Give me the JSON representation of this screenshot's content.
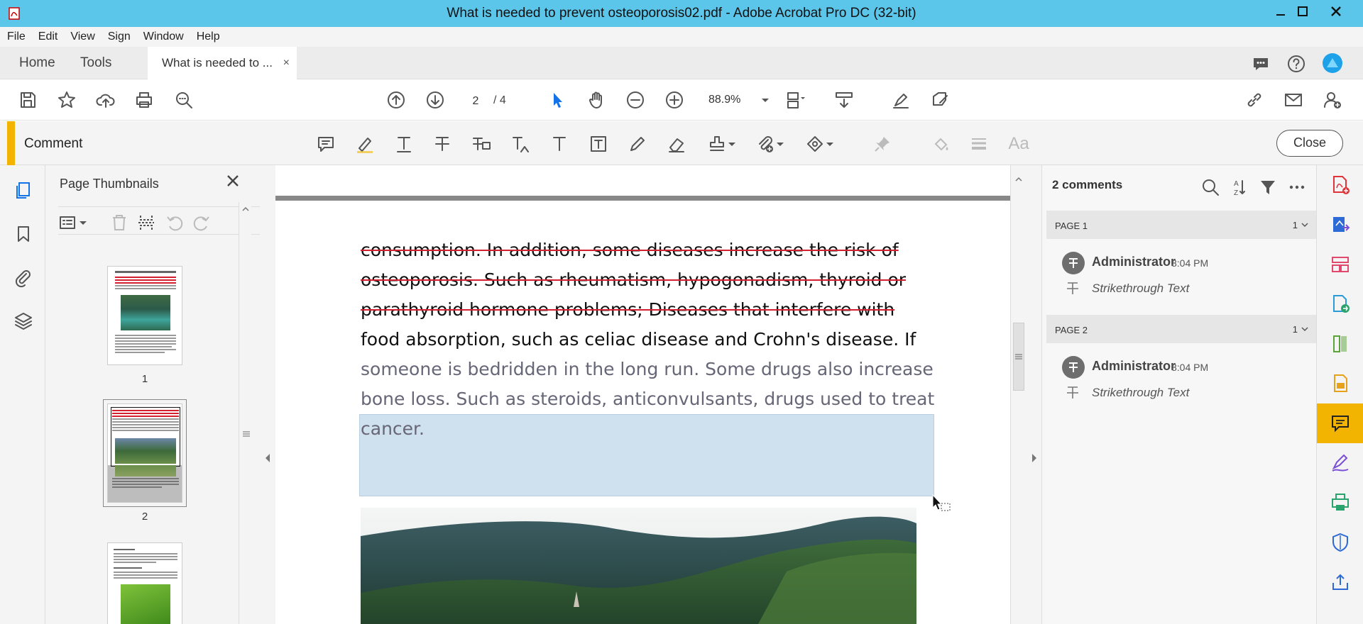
{
  "window": {
    "title": "What is needed to prevent osteoporosis02.pdf - Adobe Acrobat Pro DC (32-bit)"
  },
  "menu": [
    "File",
    "Edit",
    "View",
    "Sign",
    "Window",
    "Help"
  ],
  "tabs": {
    "home": "Home",
    "tools": "Tools",
    "document": "What is needed to ...",
    "document_close": "×"
  },
  "toolbar": {
    "current_page": "2",
    "page_total": "/ 4",
    "zoom": "88.9%"
  },
  "comment_toolbar": {
    "label": "Comment",
    "close_label": "Close"
  },
  "thumbnails": {
    "title": "Page Thumbnails",
    "pages": [
      "1",
      "2"
    ]
  },
  "document": {
    "struck_lines": [
      "consumption. In addition, some diseases increase the risk of",
      "osteoporosis. Such as rheumatism, hypogonadism, thyroid or",
      "parathyroid hormone problems; Diseases that interfere with"
    ],
    "normal_line": "food absorption, such as celiac disease and Crohn's disease. If",
    "selected_lines": [
      "someone is bedridden in the long run. Some drugs also increase",
      "bone loss. Such as steroids, anticonvulsants, drugs used to treat",
      "cancer."
    ]
  },
  "comments": {
    "count_label": "2 comments",
    "groups": [
      {
        "page": "PAGE 1",
        "count": "1",
        "author": "Administrator",
        "time": "8:04 PM",
        "type": "Strikethrough Text"
      },
      {
        "page": "PAGE 2",
        "count": "1",
        "author": "Administrator",
        "time": "8:04 PM",
        "type": "Strikethrough Text"
      }
    ]
  },
  "colors": {
    "titlebar": "#5bc5ea",
    "accent": "#f2b400",
    "strike": "#d2202f",
    "selection": "#cfe0ee"
  }
}
